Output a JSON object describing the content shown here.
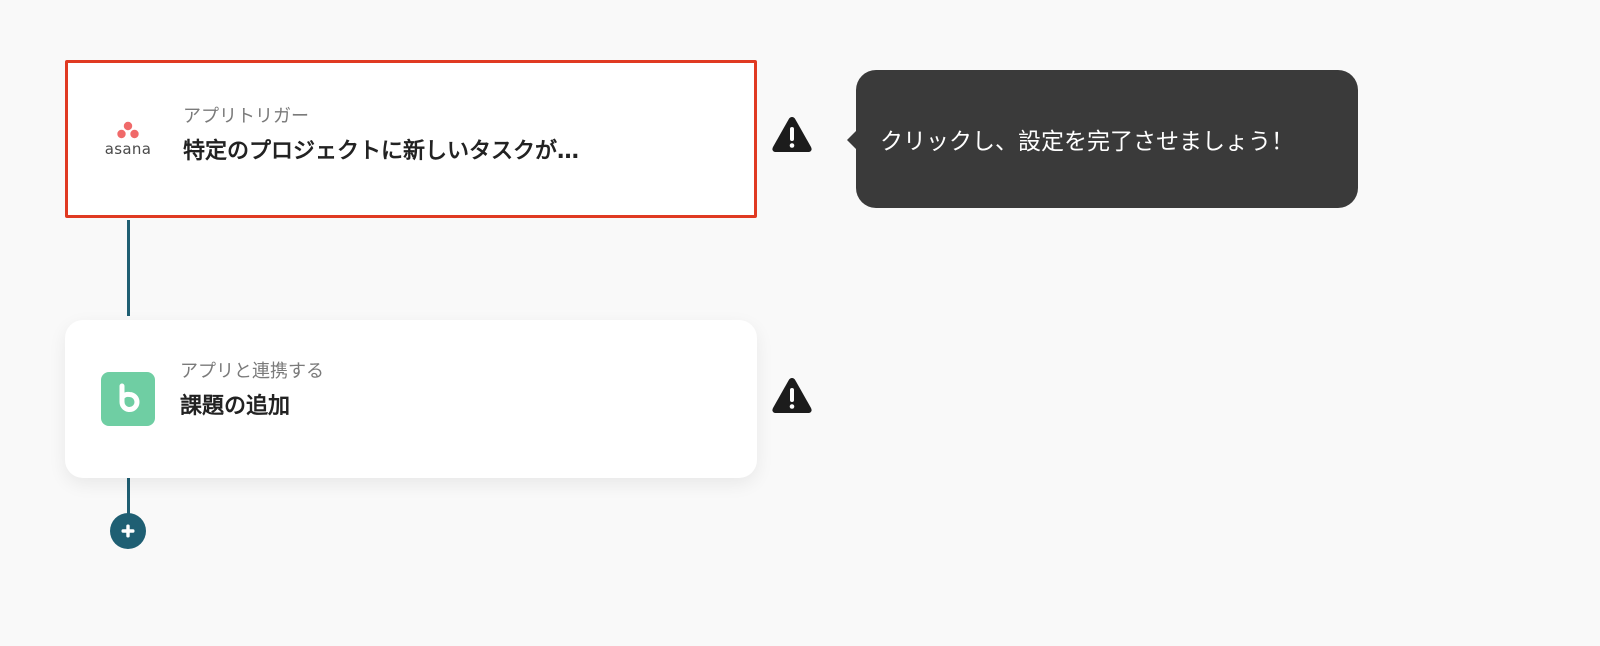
{
  "flow": {
    "steps": [
      {
        "label": "アプリトリガー",
        "title": "特定のプロジェクトに新しいタスクが…",
        "app_icon": "asana-logo",
        "app_wordmark": "asana",
        "status": "selected-incomplete"
      },
      {
        "label": "アプリと連携する",
        "title": "課題の追加",
        "app_icon": "backlog-logo",
        "status": "incomplete"
      }
    ],
    "tooltip": "クリックし、設定を完了させましょう！",
    "icons": {
      "warning": "warning-icon",
      "add": "plus-icon"
    }
  },
  "colors": {
    "selection_border": "#e03a22",
    "connector": "#1f5f73",
    "tooltip_bg": "#3a3a3a",
    "backlog_green": "#6fcea3",
    "asana_pink": "#f06a6a"
  }
}
